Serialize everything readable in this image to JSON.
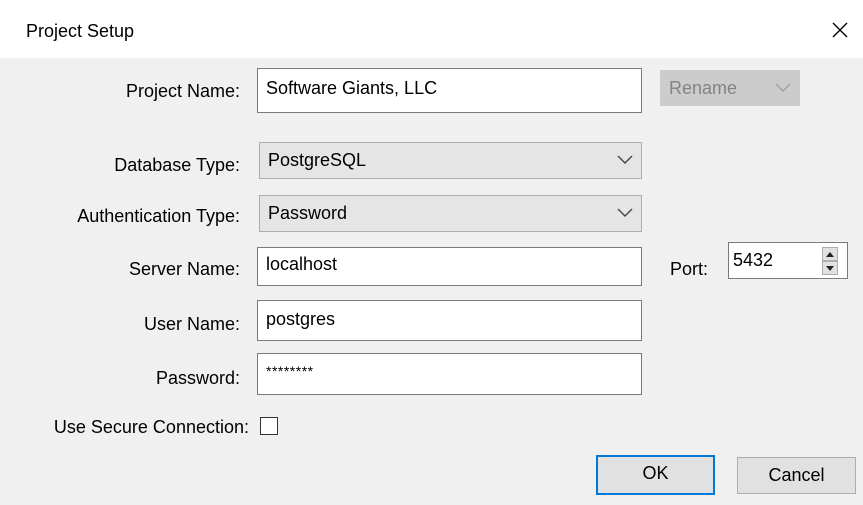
{
  "window": {
    "title": "Project Setup",
    "close_icon": "close-icon"
  },
  "form": {
    "project_name": {
      "label": "Project Name:",
      "value": "Software Giants, LLC"
    },
    "rename": {
      "label": "Rename",
      "enabled": false
    },
    "database_type": {
      "label": "Database Type:",
      "value": "PostgreSQL"
    },
    "authentication_type": {
      "label": "Authentication Type:",
      "value": "Password"
    },
    "server_name": {
      "label": "Server Name:",
      "value": "localhost"
    },
    "port": {
      "label": "Port:",
      "value": "5432"
    },
    "user_name": {
      "label": "User Name:",
      "value": "postgres"
    },
    "password": {
      "label": "Password:",
      "value": "********"
    },
    "secure_connection": {
      "label": "Use Secure Connection:",
      "checked": false
    }
  },
  "buttons": {
    "ok": "OK",
    "cancel": "Cancel"
  },
  "colors": {
    "dialog_bg": "#f0f0f0",
    "titlebar_bg": "#ffffff",
    "focus_accent": "#0078d7",
    "disabled_text": "#838383"
  }
}
